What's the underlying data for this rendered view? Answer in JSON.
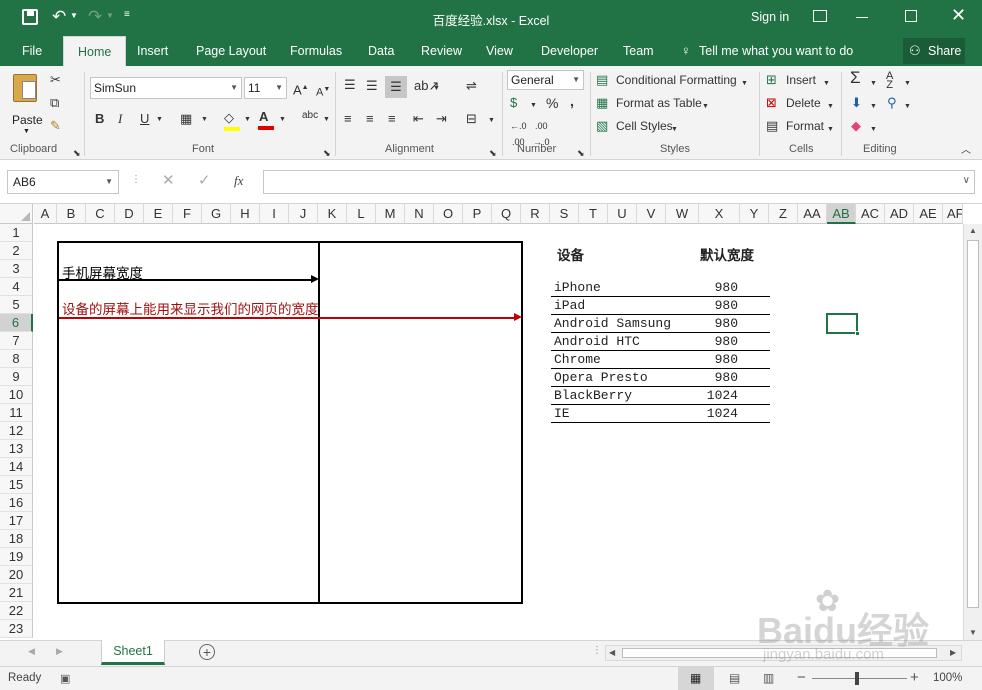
{
  "window": {
    "title": "百度经验.xlsx - Excel",
    "sign_in": "Sign in"
  },
  "ribbon_tabs": [
    "File",
    "Home",
    "Insert",
    "Page Layout",
    "Formulas",
    "Data",
    "Review",
    "View",
    "Developer",
    "Team"
  ],
  "tell_me": "Tell me what you want to do",
  "share": "Share",
  "clipboard": {
    "paste": "Paste",
    "label": "Clipboard"
  },
  "font": {
    "name": "SimSun",
    "size": "11",
    "label": "Font"
  },
  "alignment": {
    "label": "Alignment"
  },
  "number": {
    "format": "General",
    "label": "Number",
    "percent": "%",
    "comma": ","
  },
  "styles": {
    "conditional": "Conditional Formatting",
    "format_table": "Format as Table",
    "cell_styles": "Cell Styles",
    "label": "Styles"
  },
  "cells": {
    "insert": "Insert",
    "delete": "Delete",
    "format": "Format",
    "label": "Cells"
  },
  "editing": {
    "label": "Editing"
  },
  "formula_bar": {
    "name_box": "AB6",
    "fx": "fx",
    "value": ""
  },
  "columns": [
    "A",
    "B",
    "C",
    "D",
    "E",
    "F",
    "G",
    "H",
    "I",
    "J",
    "K",
    "L",
    "M",
    "N",
    "O",
    "P",
    "Q",
    "R",
    "S",
    "T",
    "U",
    "V",
    "W",
    "X",
    "Y",
    "Z",
    "AA",
    "AB",
    "AC",
    "AD",
    "AE",
    "AF"
  ],
  "rows": [
    "1",
    "2",
    "3",
    "4",
    "5",
    "6",
    "7",
    "8",
    "9",
    "10",
    "11",
    "12",
    "13",
    "14",
    "15",
    "16",
    "17",
    "18",
    "19",
    "20",
    "21",
    "22",
    "23"
  ],
  "diagram": {
    "label_phone": "手机屏幕宽度",
    "label_viewport": "设备的屏幕上能用来显示我们的网页的宽度"
  },
  "table": {
    "header_device": "设备",
    "header_width": "默认宽度",
    "rows": [
      {
        "device": "iPhone",
        "width": "980"
      },
      {
        "device": "iPad",
        "width": "980"
      },
      {
        "device": "Android Samsung",
        "width": "980"
      },
      {
        "device": "Android HTC",
        "width": "980"
      },
      {
        "device": "Chrome",
        "width": "980"
      },
      {
        "device": "Opera Presto",
        "width": "980"
      },
      {
        "device": "BlackBerry",
        "width": "1024"
      },
      {
        "device": "IE",
        "width": "1024"
      }
    ]
  },
  "sheet_tab": "Sheet1",
  "status": {
    "ready": "Ready",
    "zoom": "100%"
  },
  "watermark": {
    "brand": "Baidu经验",
    "url": "jingyan.baidu.com"
  },
  "colors": {
    "accent": "#217346",
    "red_line": "#c00000"
  }
}
